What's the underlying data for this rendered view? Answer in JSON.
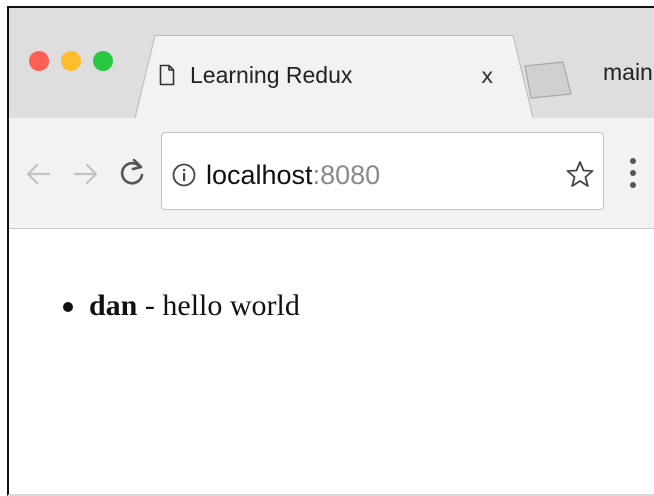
{
  "browser": {
    "tab": {
      "title": "Learning Redux",
      "close_glyph": "x",
      "icon": "file-icon"
    },
    "new_tab_icon": "new-tab-icon",
    "window_label": "main",
    "traffic_lights": {
      "close_color": "#ff5f57",
      "minimize_color": "#febc2e",
      "zoom_color": "#28c840"
    },
    "toolbar": {
      "back_icon": "arrow-left-icon",
      "forward_icon": "arrow-right-icon",
      "reload_icon": "reload-icon",
      "site_info_icon": "info-icon",
      "bookmark_icon": "star-icon",
      "menu_icon": "kebab-menu-icon"
    },
    "address_bar": {
      "host": "localhost",
      "port": ":8080"
    }
  },
  "page": {
    "messages": [
      {
        "user": "dan",
        "separator": " - ",
        "text": "hello world"
      }
    ]
  }
}
